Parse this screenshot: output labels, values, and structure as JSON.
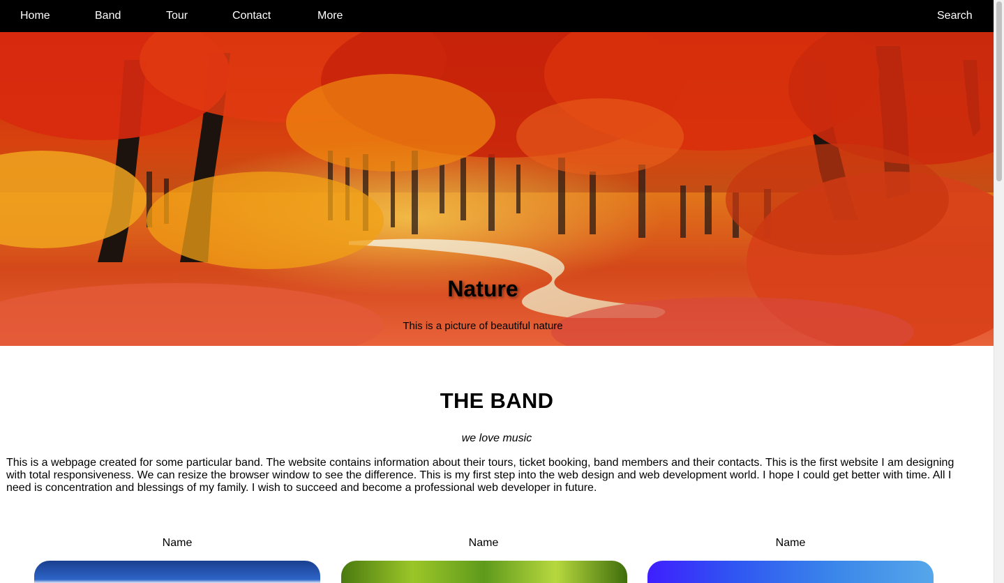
{
  "navbar": {
    "items": [
      "Home",
      "Band",
      "Tour",
      "Contact",
      "More"
    ],
    "search_label": "Search"
  },
  "hero": {
    "title": "Nature",
    "subtitle": "This is a picture of beautiful nature"
  },
  "band": {
    "title": "THE BAND",
    "tagline": "we love music",
    "description": "This is a webpage created for some particular band. The website contains information about their tours, ticket booking, band members and their contacts. This is the first website I am designing with total responsiveness. We can resize the browser window to see the difference. This is my first step into the web design and web development world. I hope I could get better with time. All I need is concentration and blessings of my family. I wish to succeed and become a professional web developer in future."
  },
  "members": [
    {
      "name": "Name"
    },
    {
      "name": "Name"
    },
    {
      "name": "Name"
    }
  ],
  "colors": {
    "navbar_bg": "#000000",
    "navbar_text": "#ffffff",
    "foliage_red": "#d42a0c",
    "foliage_orange": "#f08a10"
  }
}
